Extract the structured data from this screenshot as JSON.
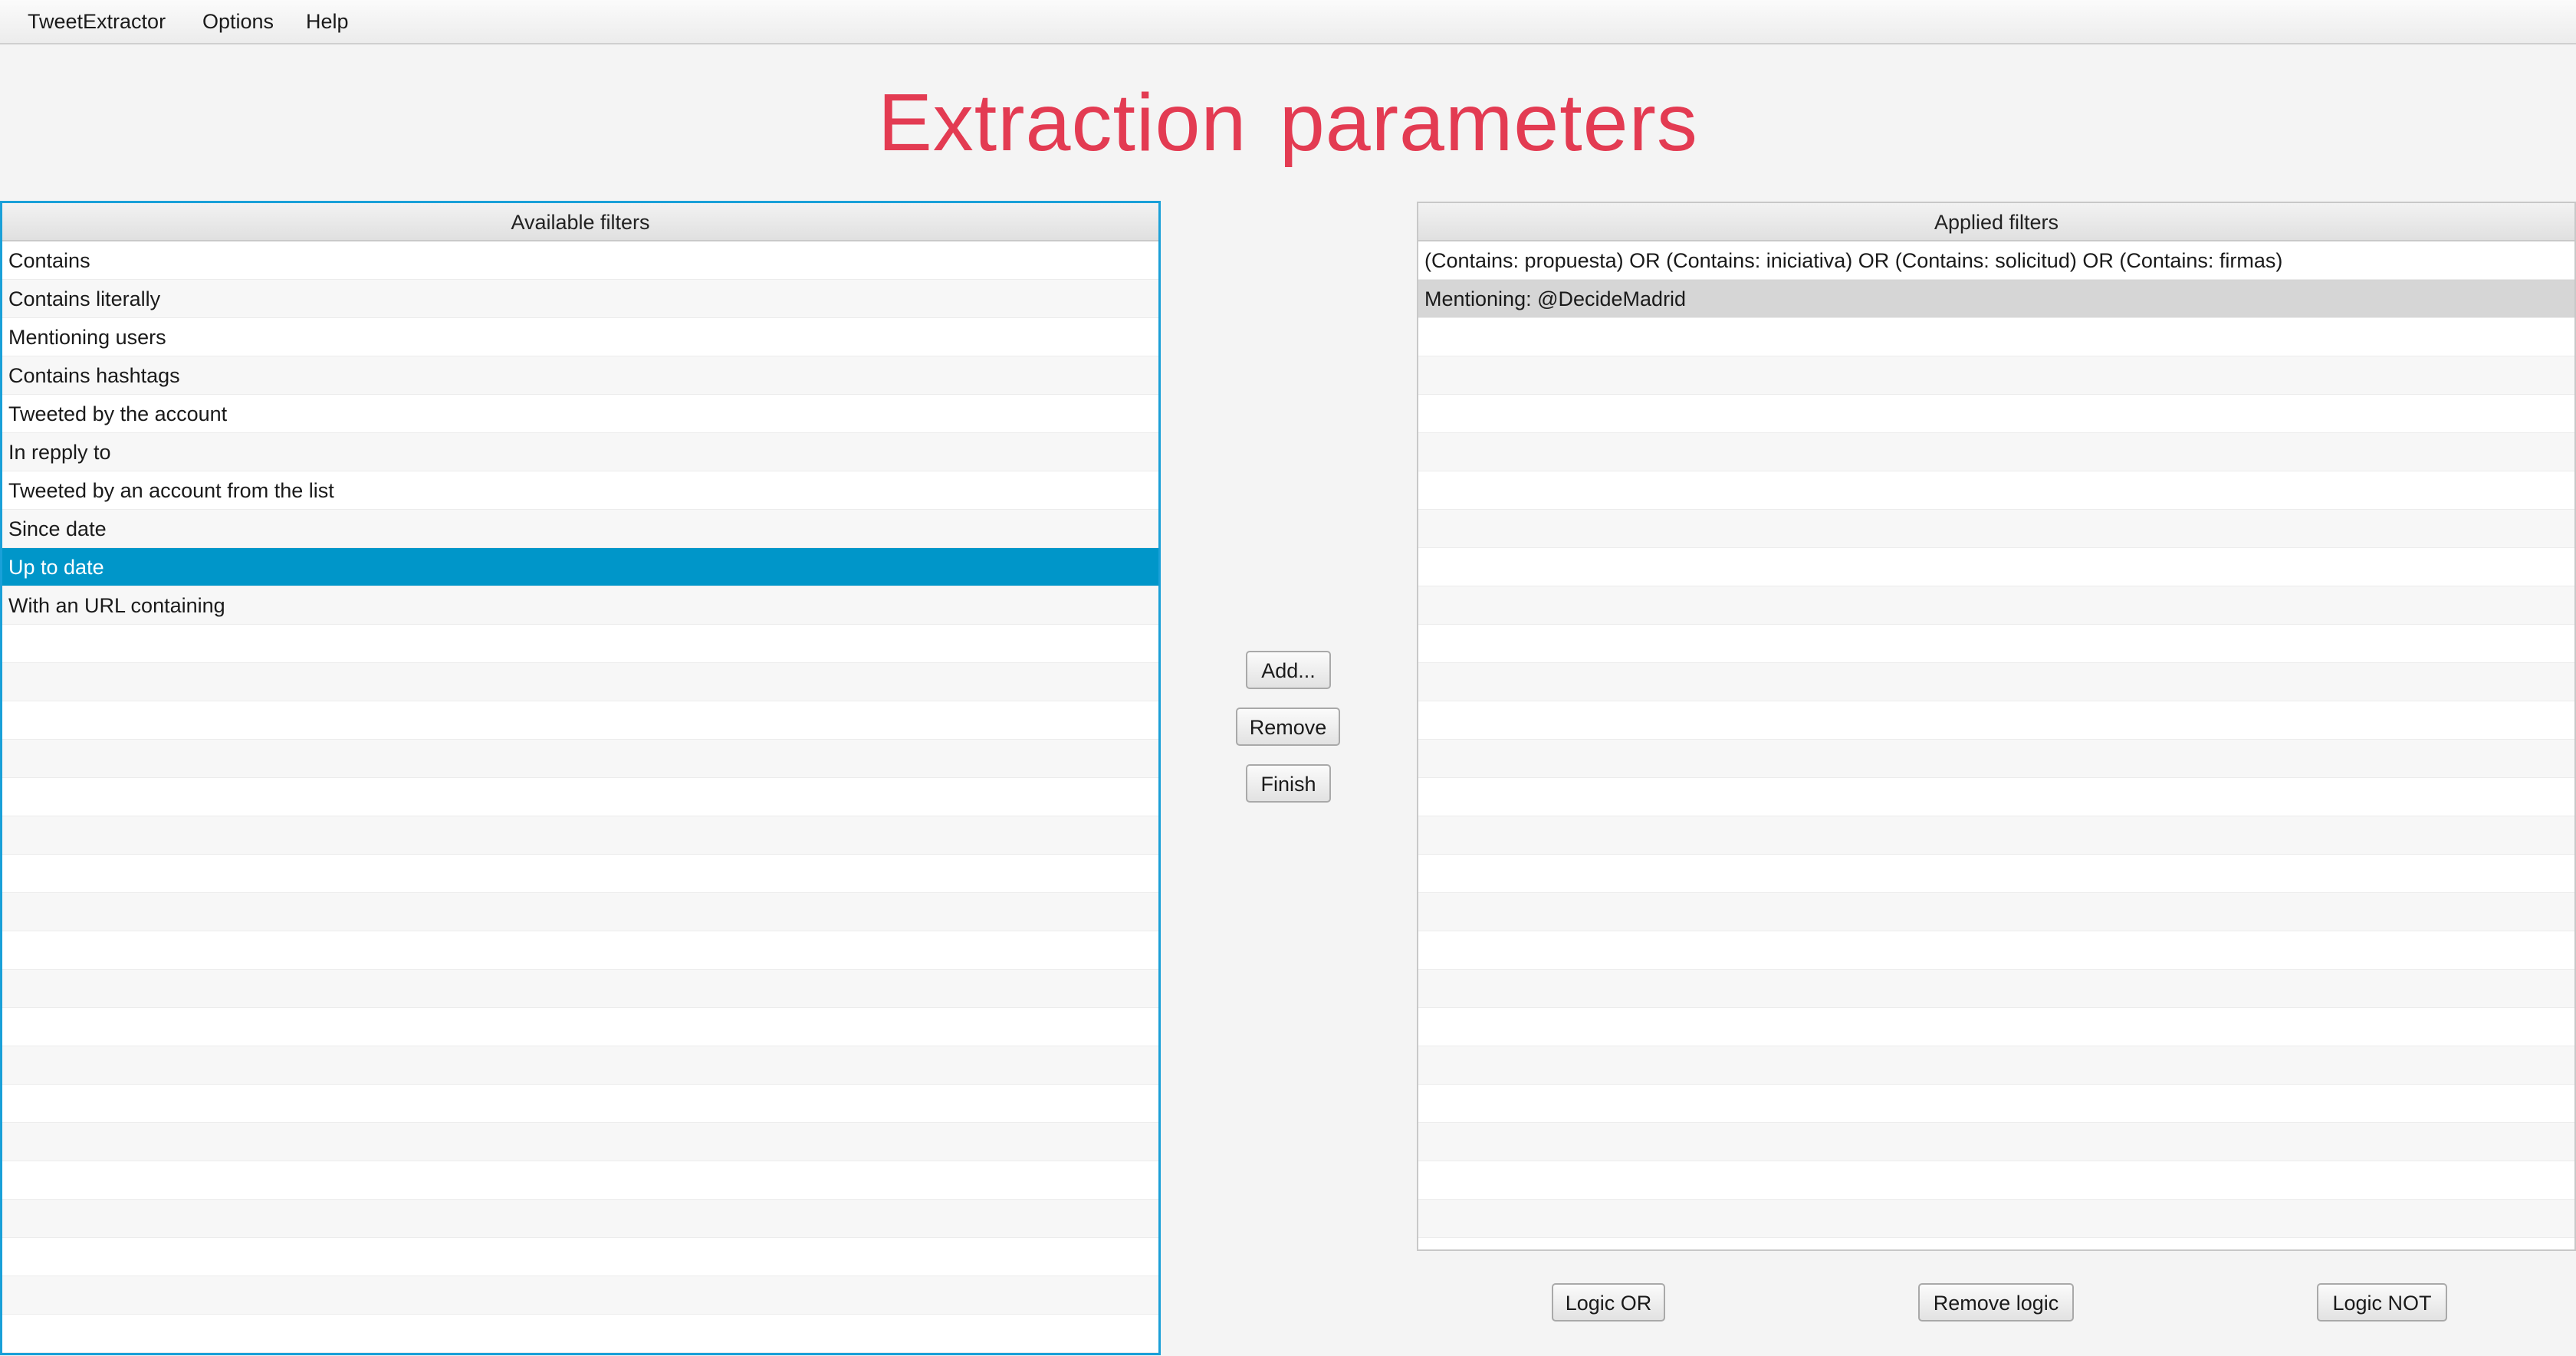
{
  "menu": [
    "TweetExtractor",
    "Options",
    "Help"
  ],
  "title": "Extraction  parameters",
  "available": {
    "header": "Available filters",
    "items": [
      "Contains",
      "Contains literally",
      "Mentioning users",
      "Contains hashtags",
      "Tweeted by the account",
      "In repply to",
      "Tweeted by an account from the list",
      "Since date",
      "Up to date",
      "With an URL containing"
    ],
    "selected_index": 8
  },
  "applied": {
    "header": "Applied filters",
    "items": [
      "(Contains: propuesta) OR (Contains: iniciativa) OR (Contains: solicitud) OR (Contains: firmas)",
      "Mentioning: @DecideMadrid"
    ],
    "highlighted_index": 1
  },
  "buttons": {
    "add": "Add...",
    "remove": "Remove",
    "finish": "Finish",
    "logic_or": "Logic OR",
    "remove_logic": "Remove logic",
    "logic_not": "Logic NOT"
  },
  "colors": {
    "title": "#e33b52",
    "selection": "#0096c9",
    "focus_border": "#1aa0d8"
  }
}
